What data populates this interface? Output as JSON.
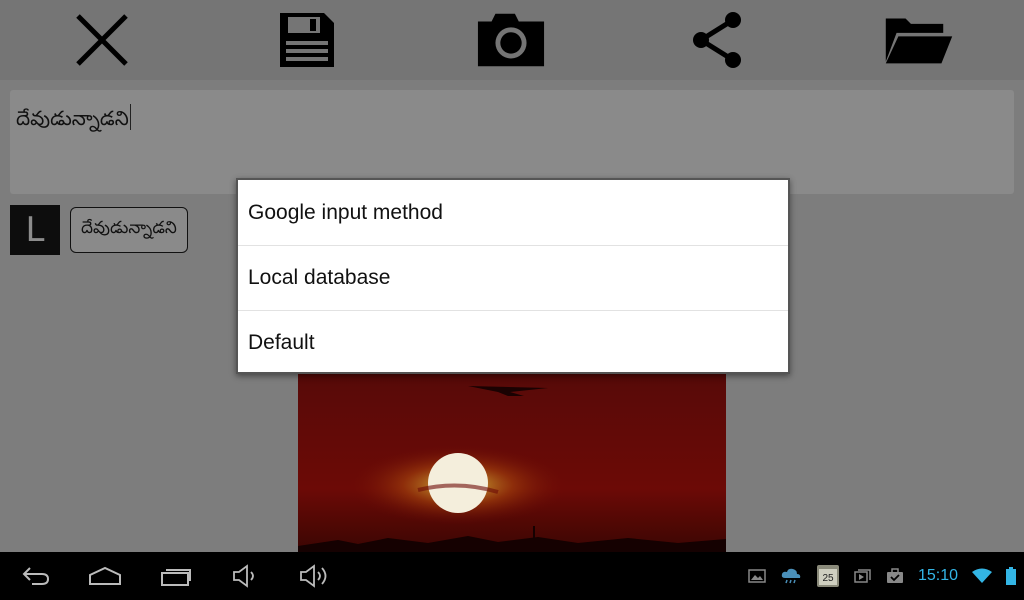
{
  "toolbar": {
    "icons": [
      "close-icon",
      "save-icon",
      "camera-icon",
      "share-icon",
      "folder-open-icon"
    ]
  },
  "editor": {
    "text": "దేవుడున్నాడని"
  },
  "language_button": {
    "label": "L"
  },
  "suggestion": {
    "text": "దేవుడున్నాడని"
  },
  "dialog": {
    "items": [
      {
        "label": "Google input method"
      },
      {
        "label": "Local database"
      },
      {
        "label": "Default"
      }
    ]
  },
  "system_bar": {
    "nav_icons": [
      "back-icon",
      "home-icon",
      "recent-apps-icon",
      "volume-down-icon",
      "volume-up-icon"
    ],
    "calendar_day": "25",
    "time": "15:10",
    "accent_color": "#33b5e5"
  },
  "colors": {
    "scrim": "#7d7d7d",
    "dialog_background": "#ffffff",
    "system_bar": "#000000"
  }
}
